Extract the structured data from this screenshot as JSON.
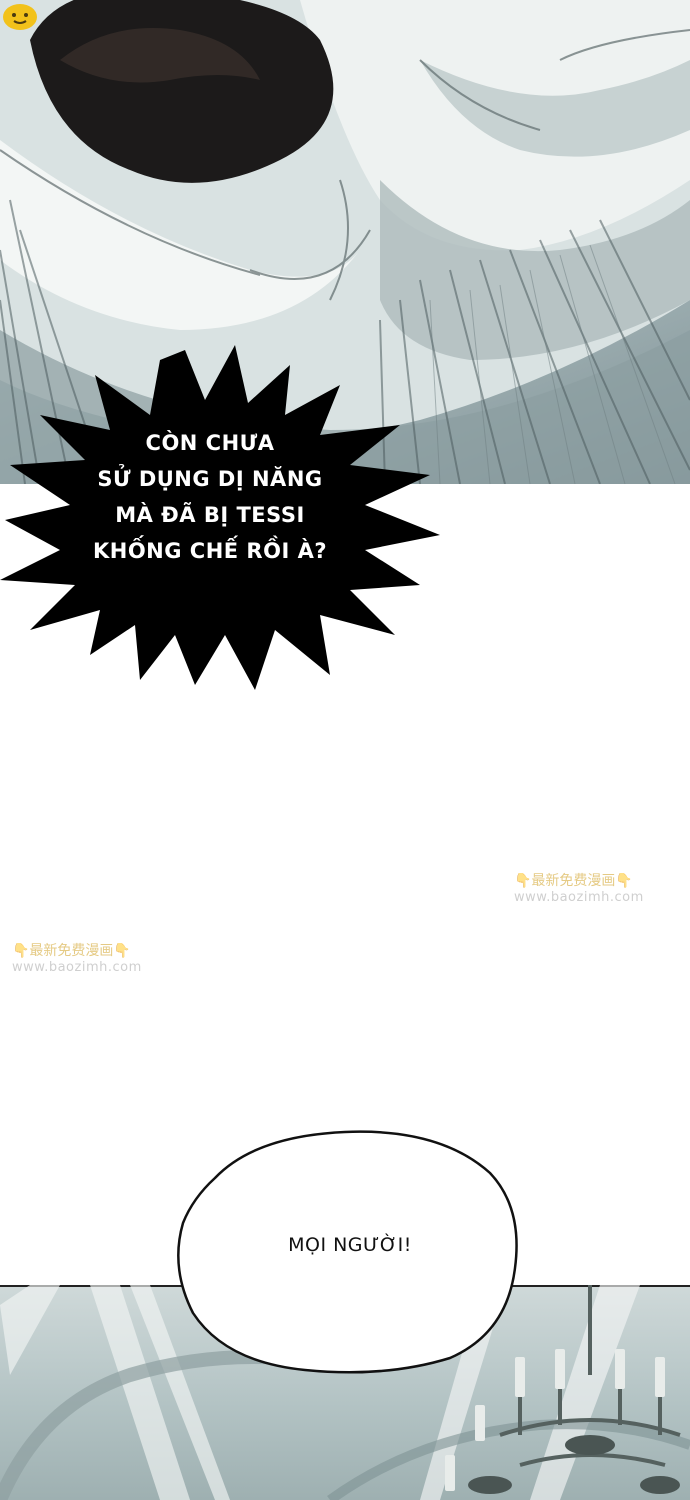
{
  "speech": {
    "burst_lines": [
      "CÒN CHƯA",
      "SỬ DỤNG DỊ NĂNG",
      "MÀ ĐÃ BỊ TESSI",
      "KHỐNG CHẾ RỒI À?"
    ],
    "bubble_text": "MỌI NGƯỜI!"
  },
  "watermarks": {
    "a": {
      "line1": "👇最新免费漫画👇",
      "line2": "www.baozimh.com"
    },
    "b": {
      "line1": "👇最新免费漫画👇",
      "line2": "www.baozimh.com"
    }
  },
  "colors": {
    "burst_fill": "#000000",
    "panel_tint": "#9fb0b3",
    "logo_yellow": "#f2c21b"
  }
}
